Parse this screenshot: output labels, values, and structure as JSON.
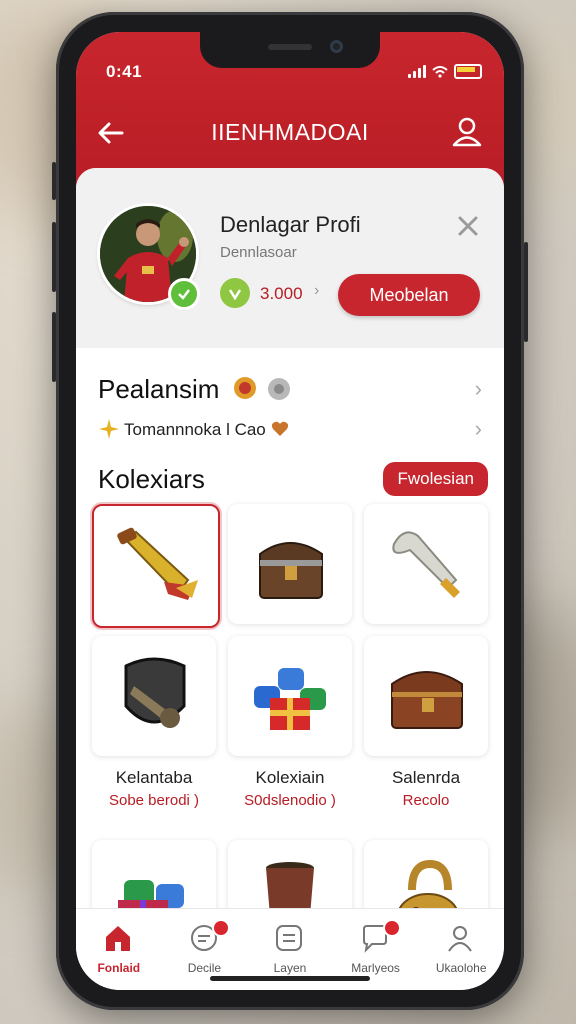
{
  "status": {
    "time": "0:41"
  },
  "header": {
    "title": "IIENHMADOAI"
  },
  "profile": {
    "name": "Denlagar Profi",
    "subtitle": "Dennlasoar",
    "coins": "3.000",
    "redeem_label": "Meobelan"
  },
  "promotions": {
    "title": "Pealansim",
    "subtitle": "Tomannnoka l Cao"
  },
  "collection": {
    "title": "Kolexiars",
    "filter_label": "Fwolesian",
    "items": [
      {
        "icon": "golden-horn-icon",
        "name": "",
        "sub": "",
        "selected": true
      },
      {
        "icon": "treasure-chest-icon",
        "name": "",
        "sub": ""
      },
      {
        "icon": "silver-trophy-torch-icon",
        "name": "",
        "sub": ""
      },
      {
        "icon": "shield-horn-icon",
        "name": "Kelantaba",
        "sub": "Sobe berodi )"
      },
      {
        "icon": "gift-bundle-icon",
        "name": "Kolexiain",
        "sub": "S0dslenodio )"
      },
      {
        "icon": "brown-chest-icon",
        "name": "Salenrda",
        "sub": "Recolo"
      },
      {
        "icon": "gift-pack-icon",
        "name": "",
        "sub": ""
      },
      {
        "icon": "bronze-cup-icon",
        "name": "",
        "sub": ""
      },
      {
        "icon": "golden-padlock-icon",
        "name": "",
        "sub": ""
      }
    ]
  },
  "nav": {
    "items": [
      {
        "label": "Fonlaid",
        "icon": "home-icon",
        "active": true
      },
      {
        "label": "Decile",
        "icon": "chat-icon",
        "badge": true
      },
      {
        "label": "Layen",
        "icon": "list-icon"
      },
      {
        "label": "Marlyeos",
        "icon": "message-icon",
        "badge": true
      },
      {
        "label": "Ukaolohe",
        "icon": "profile-icon"
      }
    ]
  },
  "colors": {
    "primary": "#c8262e",
    "badge": "#5fbf3a"
  }
}
